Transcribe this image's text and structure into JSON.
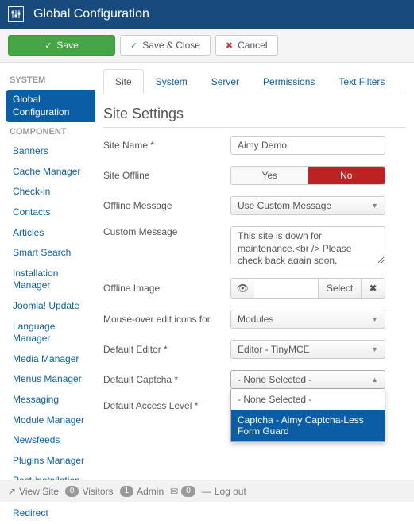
{
  "header": {
    "title": "Global Configuration"
  },
  "toolbar": {
    "save": "Save",
    "save_close": "Save & Close",
    "cancel": "Cancel"
  },
  "sidebar": {
    "system_heading": "SYSTEM",
    "system_items": [
      "Global Configuration"
    ],
    "component_heading": "COMPONENT",
    "component_items": [
      "Banners",
      "Cache Manager",
      "Check-in",
      "Contacts",
      "Articles",
      "Smart Search",
      "Installation Manager",
      "Joomla! Update",
      "Language Manager",
      "Media Manager",
      "Menus Manager",
      "Messaging",
      "Module Manager",
      "Newsfeeds",
      "Plugins Manager",
      "Post-installation Messages",
      "Redirect"
    ]
  },
  "tabs": [
    "Site",
    "System",
    "Server",
    "Permissions",
    "Text Filters"
  ],
  "section_title": "Site Settings",
  "fields": {
    "site_name": {
      "label": "Site Name *",
      "value": "Aimy Demo"
    },
    "site_offline": {
      "label": "Site Offline",
      "yes": "Yes",
      "no": "No"
    },
    "offline_message": {
      "label": "Offline Message",
      "value": "Use Custom Message"
    },
    "custom_message": {
      "label": "Custom Message",
      "value": "This site is down for maintenance.<br /> Please check back again soon."
    },
    "offline_image": {
      "label": "Offline Image",
      "select_btn": "Select"
    },
    "mouseover": {
      "label": "Mouse-over edit icons for",
      "value": "Modules"
    },
    "default_editor": {
      "label": "Default Editor *",
      "value": "Editor - TinyMCE"
    },
    "default_captcha": {
      "label": "Default Captcha *",
      "value": "- None Selected -",
      "options": [
        "- None Selected -",
        "Captcha - Aimy Captcha-Less Form Guard"
      ]
    },
    "default_access": {
      "label": "Default Access Level *"
    }
  },
  "statusbar": {
    "view_site": "View Site",
    "visitors": "Visitors",
    "visitors_count": "0",
    "admin": "Admin",
    "admin_count": "1",
    "mail_count": "0",
    "logout": "Log out"
  }
}
